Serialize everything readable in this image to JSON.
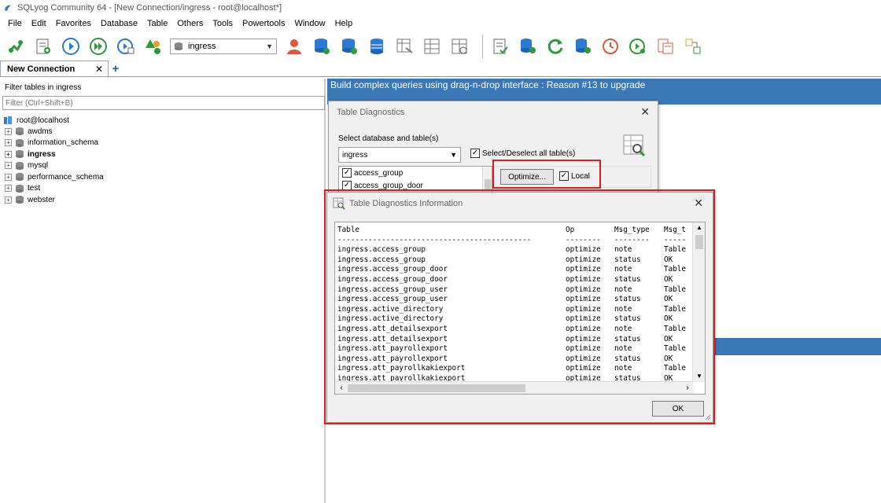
{
  "window": {
    "title": "SQLyog Community 64 - [New Connection/ingress - root@localhost*]"
  },
  "menu": [
    "File",
    "Edit",
    "Favorites",
    "Database",
    "Table",
    "Others",
    "Tools",
    "Powertools",
    "Window",
    "Help"
  ],
  "toolbar": {
    "database_select": "ingress"
  },
  "connection_tab": {
    "label": "New Connection",
    "close": "✕",
    "add": "+"
  },
  "object_browser": {
    "filter_label": "Filter tables in ingress",
    "filter_placeholder": "Filter (Ctrl+Shift+B)",
    "root": "root@localhost",
    "databases": [
      {
        "name": "awdms",
        "bold": false
      },
      {
        "name": "information_schema",
        "bold": false
      },
      {
        "name": "ingress",
        "bold": true
      },
      {
        "name": "mysql",
        "bold": false
      },
      {
        "name": "performance_schema",
        "bold": false
      },
      {
        "name": "test",
        "bold": false
      },
      {
        "name": "webster",
        "bold": false
      }
    ]
  },
  "promo": "Build complex queries using drag-n-drop interface : Reason #13 to upgrade",
  "table_diagnostics": {
    "title": "Table Diagnostics",
    "select_label": "Select database and table(s)",
    "database": "ingress",
    "select_all_label": "Select/Deselect all table(s)",
    "tables": [
      "access_group",
      "access_group_door"
    ],
    "optimize_button": "Optimize...",
    "local_label": "Local"
  },
  "diagnostics_info": {
    "title": "Table Diagnostics Information",
    "headers": [
      "Table",
      "Op",
      "Msg_type",
      "Msg_t"
    ],
    "separators": [
      "--------------------------------------------",
      "--------",
      "--------",
      "-----"
    ],
    "rows": [
      [
        "ingress.access_group",
        "optimize",
        "note",
        "Table"
      ],
      [
        "ingress.access_group",
        "optimize",
        "status",
        "OK"
      ],
      [
        "ingress.access_group_door",
        "optimize",
        "note",
        "Table"
      ],
      [
        "ingress.access_group_door",
        "optimize",
        "status",
        "OK"
      ],
      [
        "ingress.access_group_user",
        "optimize",
        "note",
        "Table"
      ],
      [
        "ingress.access_group_user",
        "optimize",
        "status",
        "OK"
      ],
      [
        "ingress.active_directory",
        "optimize",
        "note",
        "Table"
      ],
      [
        "ingress.active_directory",
        "optimize",
        "status",
        "OK"
      ],
      [
        "ingress.att_detailsexport",
        "optimize",
        "note",
        "Table"
      ],
      [
        "ingress.att_detailsexport",
        "optimize",
        "status",
        "OK"
      ],
      [
        "ingress.att_payrollexport",
        "optimize",
        "note",
        "Table"
      ],
      [
        "ingress.att_payrollexport",
        "optimize",
        "status",
        "OK"
      ],
      [
        "ingress.att_payrollkakiexport",
        "optimize",
        "note",
        "Table"
      ],
      [
        "ingress.att_payrollkakiexport",
        "optimize",
        "status",
        "OK"
      ]
    ],
    "ok_button": "OK"
  },
  "colors": {
    "accent_blue": "#3b78b8",
    "highlight_red": "#e01b1b"
  }
}
